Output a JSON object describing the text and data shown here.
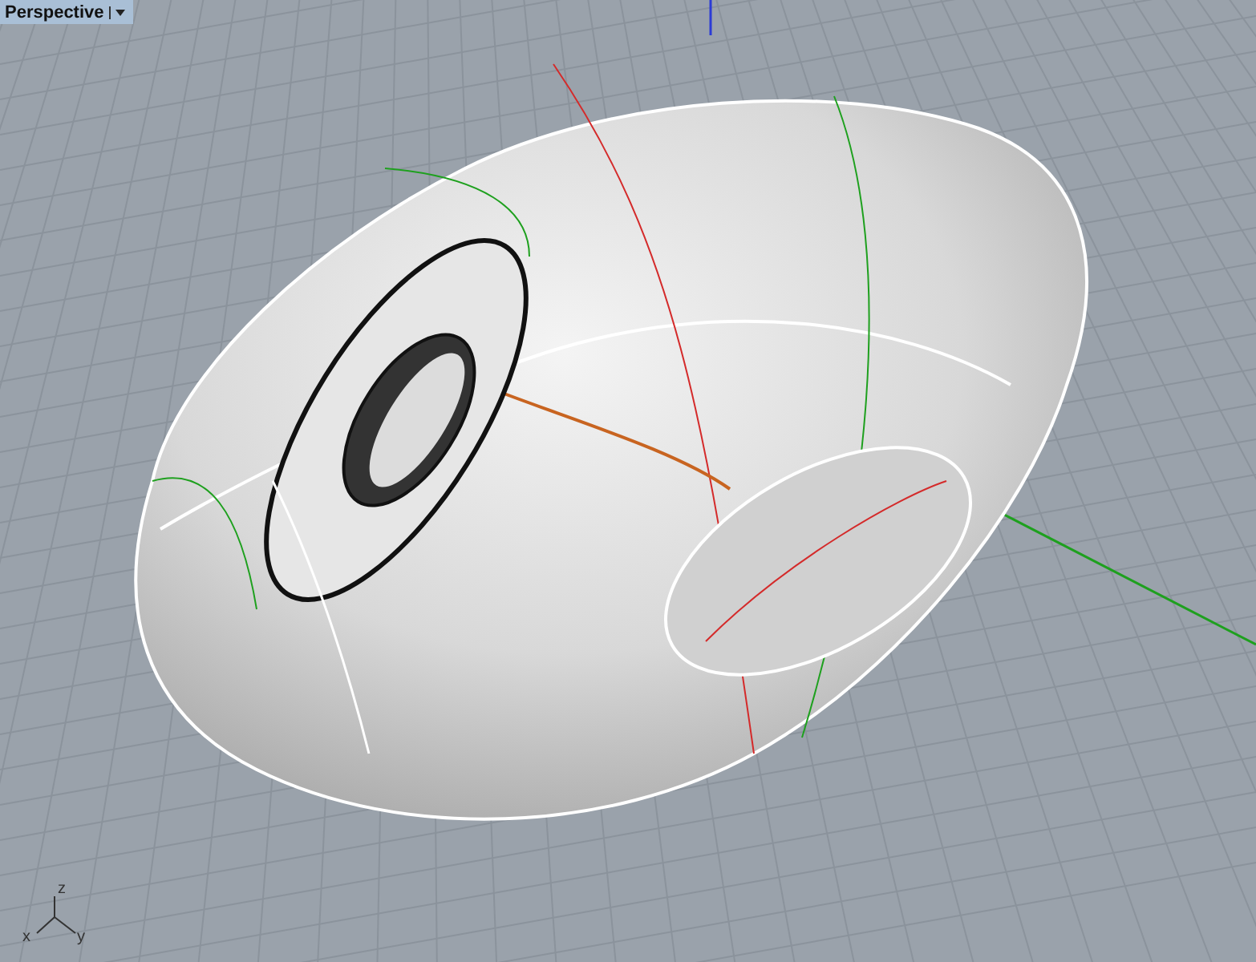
{
  "viewport": {
    "title": "Perspective",
    "axis_labels": [
      "z",
      "x",
      "y"
    ]
  }
}
